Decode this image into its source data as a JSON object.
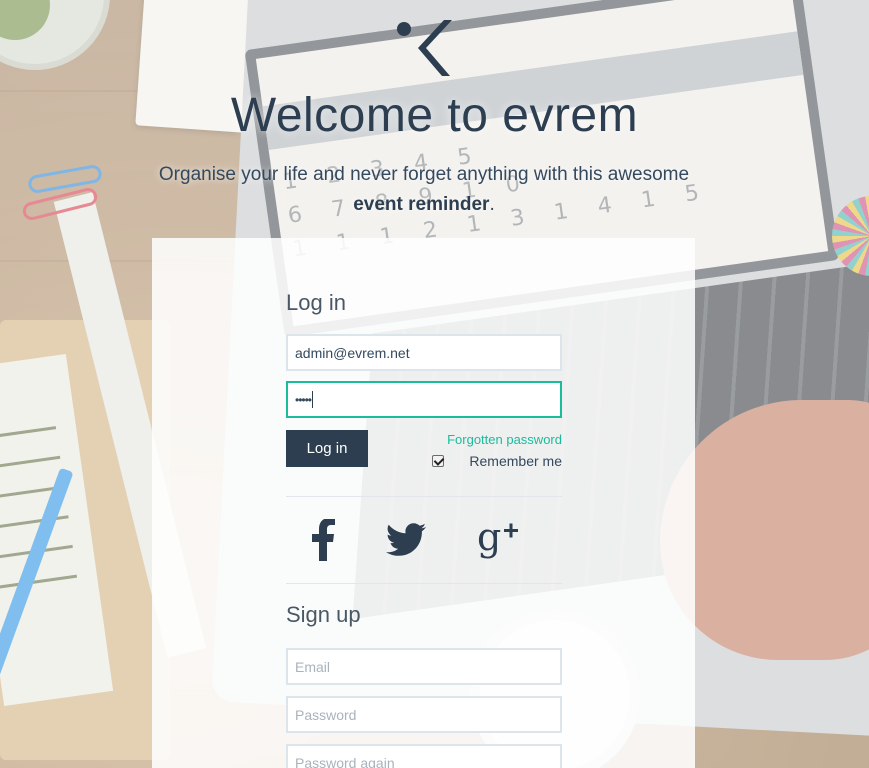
{
  "header": {
    "title": "Welcome to evrem",
    "tagline_start": "Organise your life and never forget anything with this awesome ",
    "tagline_bold": "event reminder",
    "tagline_end": "."
  },
  "login": {
    "heading": "Log in",
    "email_value": "admin@evrem.net",
    "password_masked": "•••••",
    "submit_label": "Log in",
    "forgot_label": "Forgotten password",
    "remember_label": "Remember me",
    "remember_checked": true
  },
  "social": {
    "icons": [
      "facebook-icon",
      "twitter-icon",
      "google-plus-icon"
    ]
  },
  "signup": {
    "heading": "Sign up",
    "email_placeholder": "Email",
    "password_placeholder": "Password",
    "password_again_placeholder": "Password again"
  },
  "colors": {
    "primary": "#2c3e50",
    "accent": "#1abc9c",
    "input_border": "#dce4ec"
  }
}
